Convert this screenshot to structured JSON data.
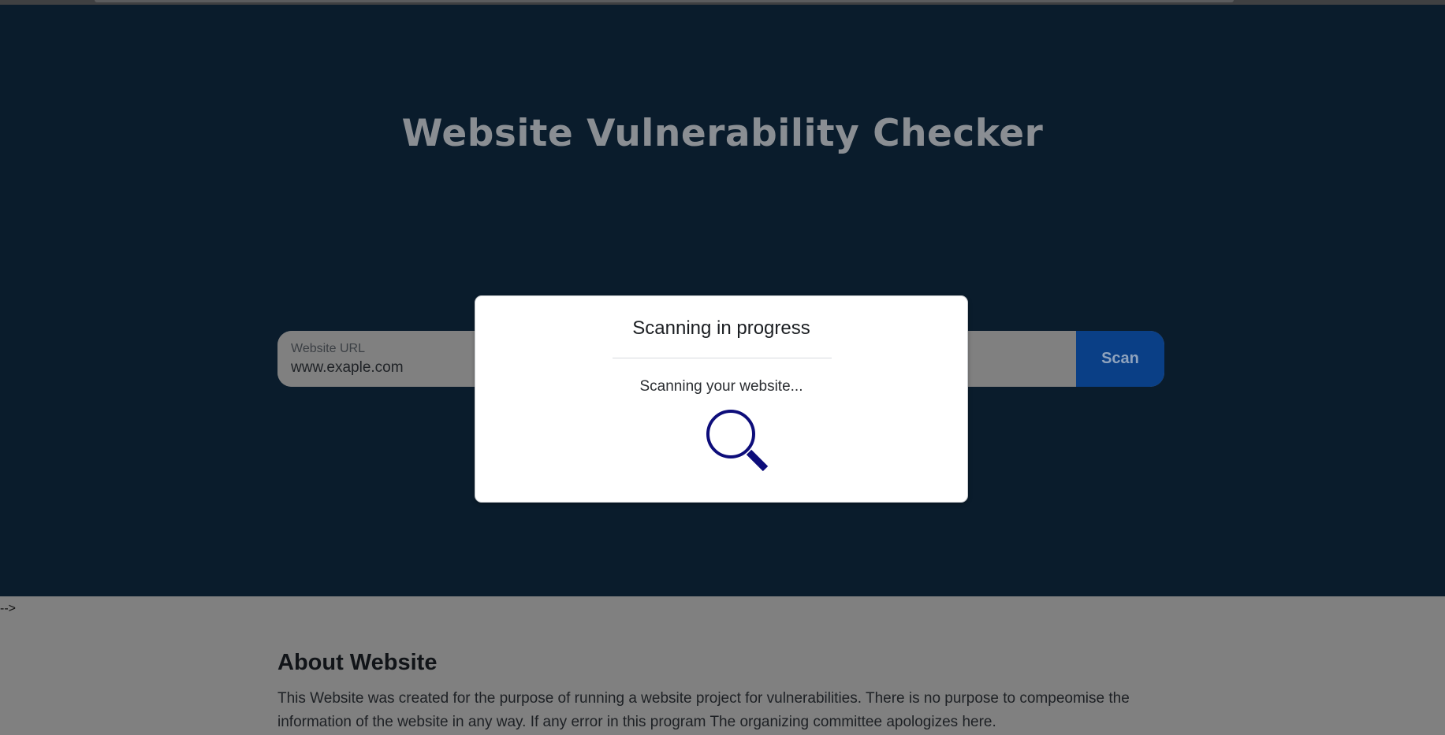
{
  "hero": {
    "title": "Website Vulnerability Checker"
  },
  "search": {
    "label": "Website URL",
    "value": "www.exaple.com",
    "button_label": "Scan"
  },
  "stray_text": "-->",
  "about": {
    "title": "About Website",
    "body": "This Website was created for the purpose of running a website project for vulnerabilities. There is no purpose to compeomise the information of the website in any way. If any error in this program The organizing committee apologizes here."
  },
  "modal": {
    "title": "Scanning in progress",
    "message": "Scanning your website...",
    "icon": "magnifier-icon",
    "icon_color": "#0d0d7a"
  },
  "colors": {
    "hero_background": "#0a1c2c",
    "scan_button": "#0a3f86",
    "overlay_gray": "#808080"
  }
}
